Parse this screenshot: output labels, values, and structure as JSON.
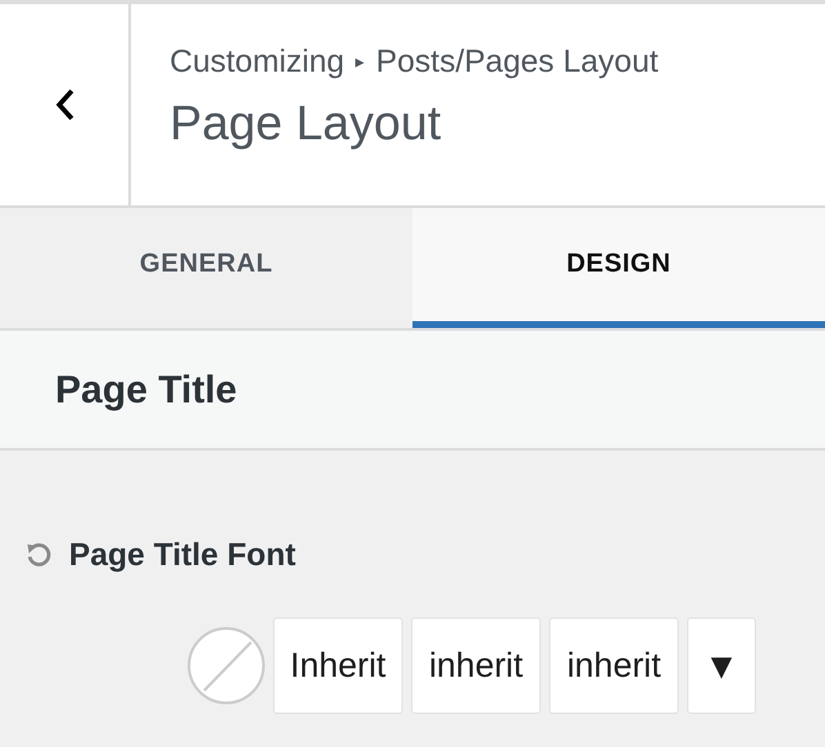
{
  "header": {
    "breadcrumb_root": "Customizing",
    "breadcrumb_separator": "▸",
    "breadcrumb_parent": "Posts/Pages Layout",
    "title": "Page Layout"
  },
  "tabs": [
    {
      "label": "GENERAL",
      "selected": false
    },
    {
      "label": "DESIGN",
      "selected": true
    }
  ],
  "section": {
    "title": "Page Title"
  },
  "control": {
    "label": "Page Title Font",
    "fields": [
      {
        "kind": "swatch"
      },
      {
        "kind": "box",
        "value": "Inherit"
      },
      {
        "kind": "box",
        "value": "inherit"
      },
      {
        "kind": "box",
        "value": "inherit"
      },
      {
        "kind": "dropdown",
        "value": "▼"
      }
    ]
  }
}
